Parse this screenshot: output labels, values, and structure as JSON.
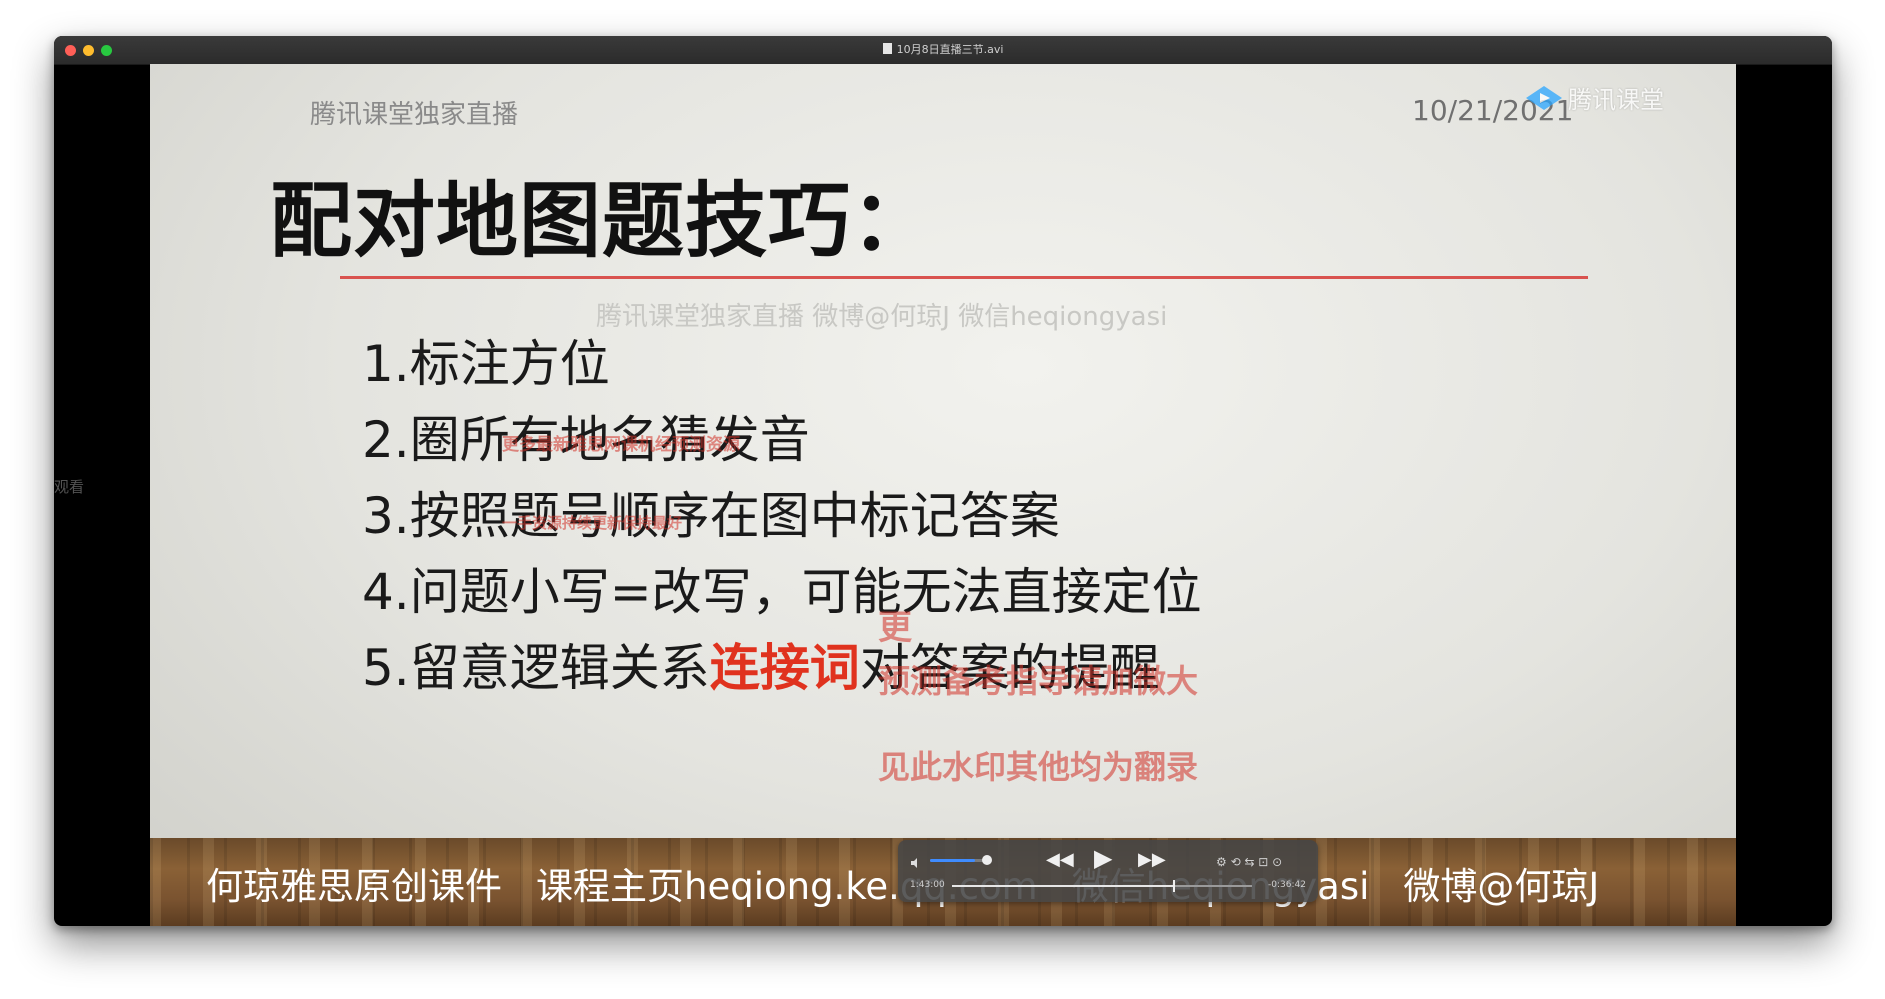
{
  "window": {
    "title": "10月8日直播三节.avi"
  },
  "side_text": "观看",
  "slide": {
    "header_left": "腾讯课堂独家直播",
    "date": "10/21/2021",
    "tencent_logo_text": "腾讯课堂",
    "title": "配对地图题技巧：",
    "watermark": "腾讯课堂独家直播  微博@何琼J  微信heqiongyasi",
    "points": [
      "1.标注方位",
      "2.圈所有地名猜发音",
      "3.按照题号顺序在图中标记答案",
      "4.问题小写=改写，可能无法直接定位",
      "5.留意逻辑关系"
    ],
    "point5_highlight": "连接词",
    "point5_tail": "对答案的提醒",
    "overlay_text": {
      "line1": "更多最新雅思网课机经预测资源",
      "line2": "一手资源持续更新保持最好",
      "line3": "更",
      "line4": "预测备考指导请加微大",
      "line5": "见此水印其他均为翻录"
    },
    "footer": {
      "item1": "何琼雅思原创课件",
      "item2": "课程主页heqiong.ke.qq.com",
      "item3": "微信heqiongyasi",
      "item4": "微博@何琼J"
    }
  },
  "player": {
    "volume": 0.75,
    "progress": 0.74,
    "elapsed": "1:43:00",
    "remaining": "-0:36:42",
    "rewind_icon": "rewind-icon",
    "play_icon": "play-icon",
    "forward_icon": "fast-forward-icon",
    "more_label": "⚙ ⟲ ⇆ ⊡ ⊙"
  },
  "colors": {
    "accent_red": "#e0321e",
    "rule_red": "#d9534f",
    "volume_blue": "#3f8cff",
    "tencent_blue": "#2aa6ff"
  }
}
